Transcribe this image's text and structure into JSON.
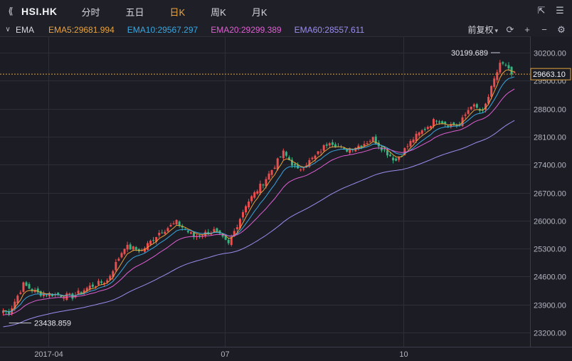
{
  "header": {
    "symbol": "HSI.HK",
    "tabs": [
      {
        "label": "分时",
        "active": false
      },
      {
        "label": "五日",
        "active": false
      },
      {
        "label": "日K",
        "active": true
      },
      {
        "label": "周K",
        "active": false
      },
      {
        "label": "月K",
        "active": false
      }
    ],
    "icons": [
      "fullscreen-icon",
      "menu-icon"
    ]
  },
  "indicator_bar": {
    "name": "EMA",
    "items": [
      {
        "label": "EMA5:29681.994",
        "color": "#e8a33c"
      },
      {
        "label": "EMA10:29567.297",
        "color": "#3aa7e0"
      },
      {
        "label": "EMA20:29299.389",
        "color": "#e05fd3"
      },
      {
        "label": "EMA60:28557.611",
        "color": "#9b8ef0"
      }
    ],
    "adjust_label": "前复权",
    "icons": [
      "refresh-icon",
      "plus-icon",
      "minus-icon",
      "settings-icon"
    ]
  },
  "chart_data": {
    "type": "candlestick",
    "y_ticks": [
      "30200.00",
      "29500.00",
      "28800.00",
      "28100.00",
      "27400.00",
      "26700.00",
      "26000.00",
      "25300.00",
      "24600.00",
      "23900.00",
      "23200.00"
    ],
    "ylim": [
      23000,
      30600
    ],
    "x_ticks": [
      {
        "label": "2017-04",
        "i": 16
      },
      {
        "label": "07",
        "i": 77
      },
      {
        "label": "10",
        "i": 139
      }
    ],
    "price_line": {
      "value": 29663.1,
      "label": "29663.10"
    },
    "annotations": [
      {
        "label": "30199.689",
        "value": 30199.689,
        "i": 172,
        "kind": "high"
      },
      {
        "label": "23438.859",
        "value": 23438.859,
        "i": 2,
        "kind": "low"
      }
    ],
    "anchors": [
      [
        0,
        23750
      ],
      [
        2,
        23700
      ],
      [
        7,
        24400
      ],
      [
        12,
        24180
      ],
      [
        18,
        24150
      ],
      [
        24,
        24100
      ],
      [
        30,
        24350
      ],
      [
        36,
        24500
      ],
      [
        42,
        25350
      ],
      [
        48,
        25250
      ],
      [
        54,
        25700
      ],
      [
        60,
        25950
      ],
      [
        66,
        25600
      ],
      [
        73,
        25750
      ],
      [
        78,
        25400
      ],
      [
        84,
        26400
      ],
      [
        90,
        26950
      ],
      [
        97,
        27700
      ],
      [
        102,
        27250
      ],
      [
        108,
        27600
      ],
      [
        113,
        28000
      ],
      [
        118,
        27750
      ],
      [
        124,
        27900
      ],
      [
        128,
        28050
      ],
      [
        132,
        27750
      ],
      [
        136,
        27500
      ],
      [
        142,
        28050
      ],
      [
        146,
        28300
      ],
      [
        150,
        28550
      ],
      [
        154,
        28400
      ],
      [
        158,
        28400
      ],
      [
        162,
        28900
      ],
      [
        166,
        28700
      ],
      [
        170,
        29500
      ],
      [
        172,
        29950
      ],
      [
        174,
        29850
      ],
      [
        176,
        29650
      ]
    ]
  }
}
